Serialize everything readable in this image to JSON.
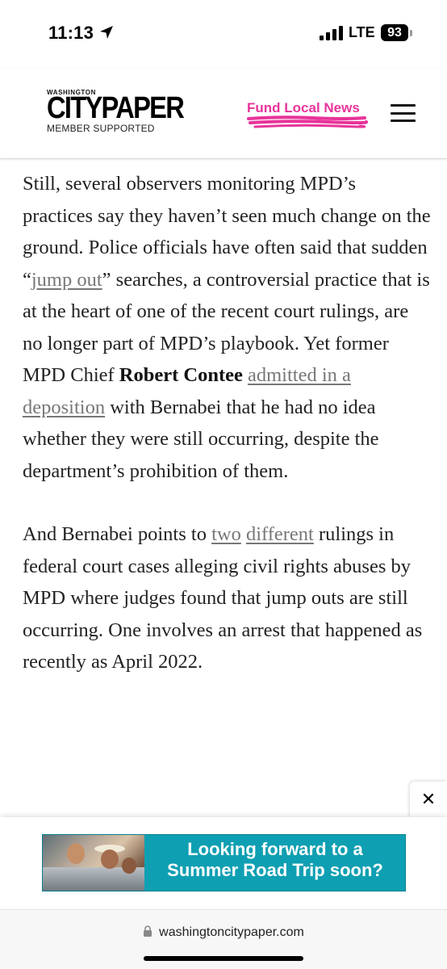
{
  "status_bar": {
    "time": "11:13",
    "network": "LTE",
    "battery": "93"
  },
  "header": {
    "logo_top": "WASHINGTON",
    "logo_main": "CITYPAPER",
    "logo_sub": "MEMBER SUPPORTED",
    "fund_link": "Fund Local News",
    "accent_color": "#e8349a",
    "menu_icon": "hamburger-menu-icon"
  },
  "article": {
    "p1": {
      "t1": "Still, several observers monitoring MPD’s practices say they haven’t seen much change on the ground. Police officials have often said that sudden “",
      "link1": "jump out",
      "t2": "” searches, a controversial practice that is at the heart of one of the recent court rulings, are no longer part of MPD’s playbook. Yet former MPD Chief ",
      "bold1": "Robert Contee",
      "t3": " ",
      "link2": "admitted in a deposition",
      "t4": " with Bernabei that he had no idea whether they were still occurring, despite the department’s prohibition of them."
    },
    "p2": {
      "t1": "And Bernabei points to ",
      "link1": "two",
      "t2": " ",
      "link2": "different",
      "t3": " rulings in federal court cases alleging civil rights abuses by MPD where judges found that jump outs are still occurring. One involves an arrest that happened as recently as April 2022."
    }
  },
  "ad": {
    "close_label": "✕",
    "line1": "Looking forward to a",
    "line2": "Summer Road Trip soon?"
  },
  "browser": {
    "url": "washingtoncitypaper.com"
  }
}
